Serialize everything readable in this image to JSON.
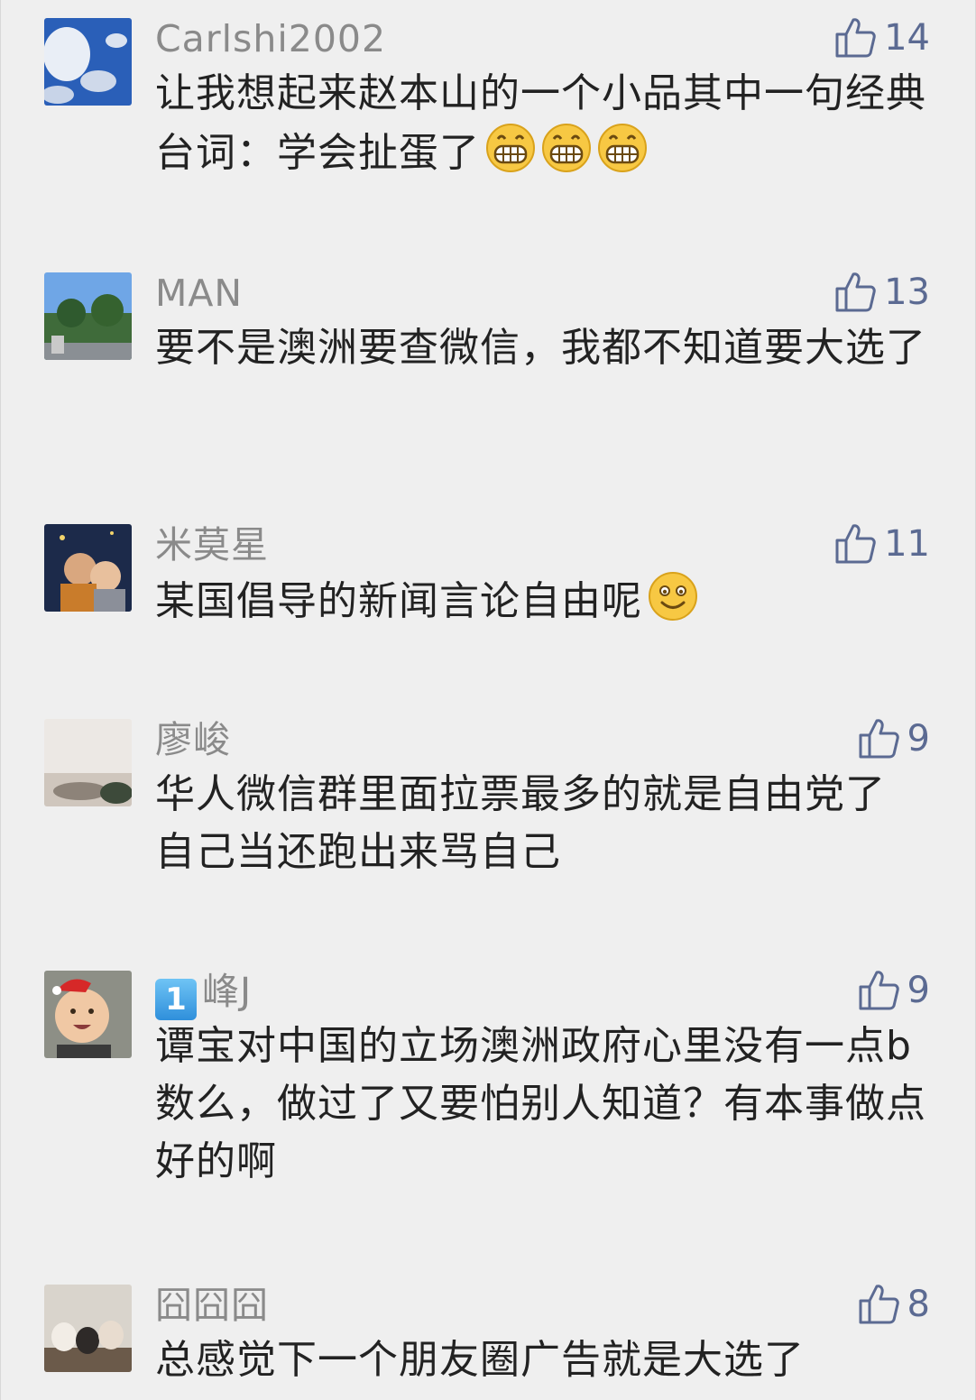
{
  "comments": [
    {
      "nickname": "Carlshi2002",
      "likes": "14",
      "text": "让我想起来赵本山的一个小品其中一句经典台词：学会扯蛋了",
      "emojis": [
        "grin-icon",
        "grin-icon",
        "grin-icon"
      ]
    },
    {
      "nickname": "MAN",
      "likes": "13",
      "text": "要不是澳洲要查微信，我都不知道要大选了"
    },
    {
      "nickname": "米莫星",
      "likes": "11",
      "text": "某国倡导的新闻言论自由呢",
      "emojis": [
        "smile-icon"
      ]
    },
    {
      "nickname": "廖峻",
      "likes": "9",
      "text": "华人微信群里面拉票最多的就是自由党了 自己当还跑出来骂自己"
    },
    {
      "nickname_badge": "1",
      "nickname": "峰J",
      "likes": "9",
      "text": "谭宝对中国的立场澳洲政府心里没有一点b数么，做过了又要怕别人知道？有本事做点好的啊"
    },
    {
      "nickname": "囧囧囧",
      "likes": "8",
      "text": "总感觉下一个朋友圈广告就是大选了"
    }
  ],
  "colors": {
    "background": "#efefef",
    "nickname": "#8a8a8a",
    "like": "#5b6a92",
    "text": "#222222"
  }
}
